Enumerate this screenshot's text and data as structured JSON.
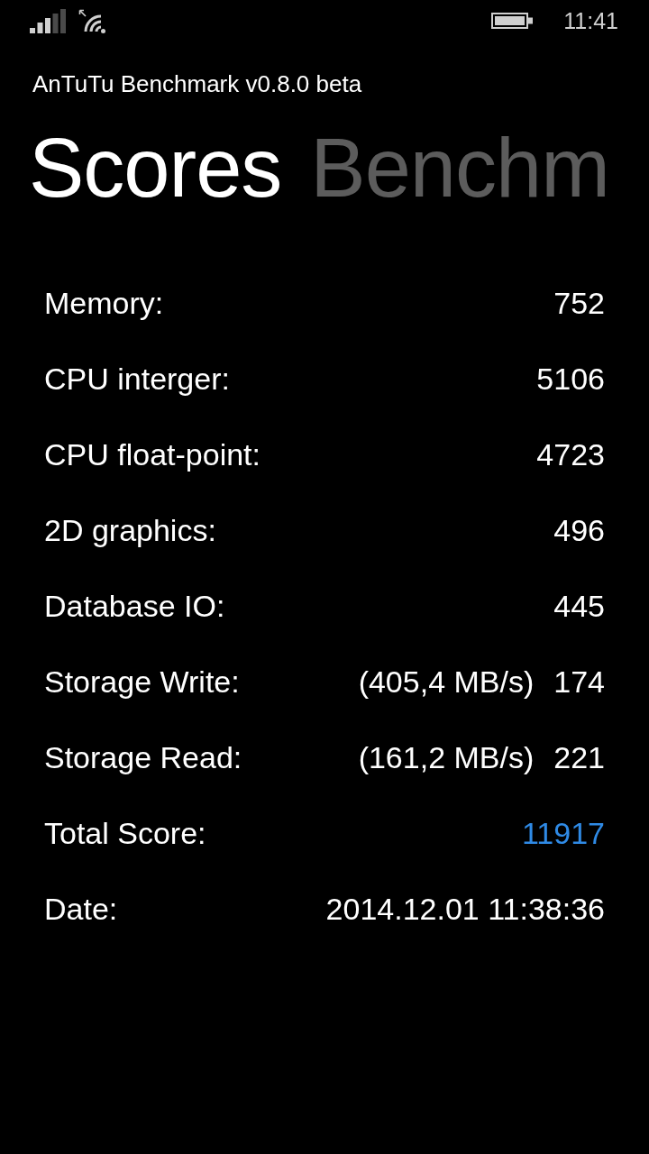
{
  "status_bar": {
    "time": "11:41"
  },
  "app_title": "AnTuTu Benchmark v0.8.0 beta",
  "pivot": [
    {
      "label": "Scores",
      "selected": true
    },
    {
      "label": "Benchm",
      "selected": false
    }
  ],
  "scores": [
    {
      "label": "Memory:",
      "value": "752",
      "highlighted": false
    },
    {
      "label": "CPU interger:",
      "value": "5106",
      "highlighted": false
    },
    {
      "label": "CPU float-point:",
      "value": "4723",
      "highlighted": false
    },
    {
      "label": "2D graphics:",
      "value": "496",
      "highlighted": false
    },
    {
      "label": "Database IO:",
      "value": "445",
      "highlighted": false
    },
    {
      "label": "Storage Write:",
      "detail": "(405,4 MB/s)",
      "value": "174",
      "highlighted": false
    },
    {
      "label": "Storage Read:",
      "detail": "(161,2 MB/s)",
      "value": "221",
      "highlighted": false
    },
    {
      "label": "Total Score:",
      "value": "11917",
      "highlighted": true
    },
    {
      "label": "Date:",
      "value": "2014.12.01 11:38:36",
      "highlighted": false
    }
  ]
}
